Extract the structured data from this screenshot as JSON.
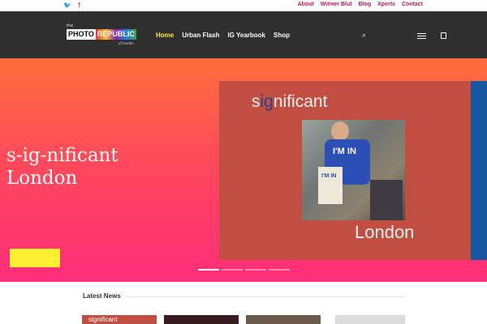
{
  "topbar": {
    "social": [
      {
        "icon": "twitter-icon",
        "glyph": "🐦"
      },
      {
        "icon": "facebook-icon",
        "glyph": "f"
      }
    ],
    "links": [
      "About",
      "Wiener Blut",
      "Blog",
      "Xperts",
      "Contact"
    ]
  },
  "header": {
    "logo": {
      "the": "the",
      "photo": "PHOTO",
      "republic": "REPUBLIC",
      "london": "of london"
    },
    "nav": [
      {
        "label": "Home",
        "active": true
      },
      {
        "label": "Urban Flash",
        "active": false
      },
      {
        "label": "IG Yearbook",
        "active": false
      },
      {
        "label": "Shop",
        "active": false
      }
    ],
    "icons": [
      "search-icon",
      "menu-icon",
      "cart-icon"
    ]
  },
  "hero": {
    "title_line1": "s-ig-nificant",
    "title_line2": "London",
    "poster": {
      "word1_pre": "s",
      "word1_ig": "ig",
      "word1_post": "nificant",
      "word2": "London",
      "shirt_text": "I'M IN",
      "bag_text": "I'M IN"
    },
    "slides": 4,
    "active_slide": 1
  },
  "news": {
    "title": "Latest News",
    "cards": [
      {
        "label": "significant"
      },
      {
        "label": ""
      },
      {
        "label": ""
      },
      {
        "label": ""
      }
    ]
  },
  "colors": {
    "accent": "#c2185b",
    "nav_active": "#ffeb3b",
    "header_bg": "#2f2f2f",
    "hero_top": "#ff6f3c",
    "hero_bottom": "#ff2d7a",
    "button": "#ffee32",
    "poster": "#c14e41"
  }
}
